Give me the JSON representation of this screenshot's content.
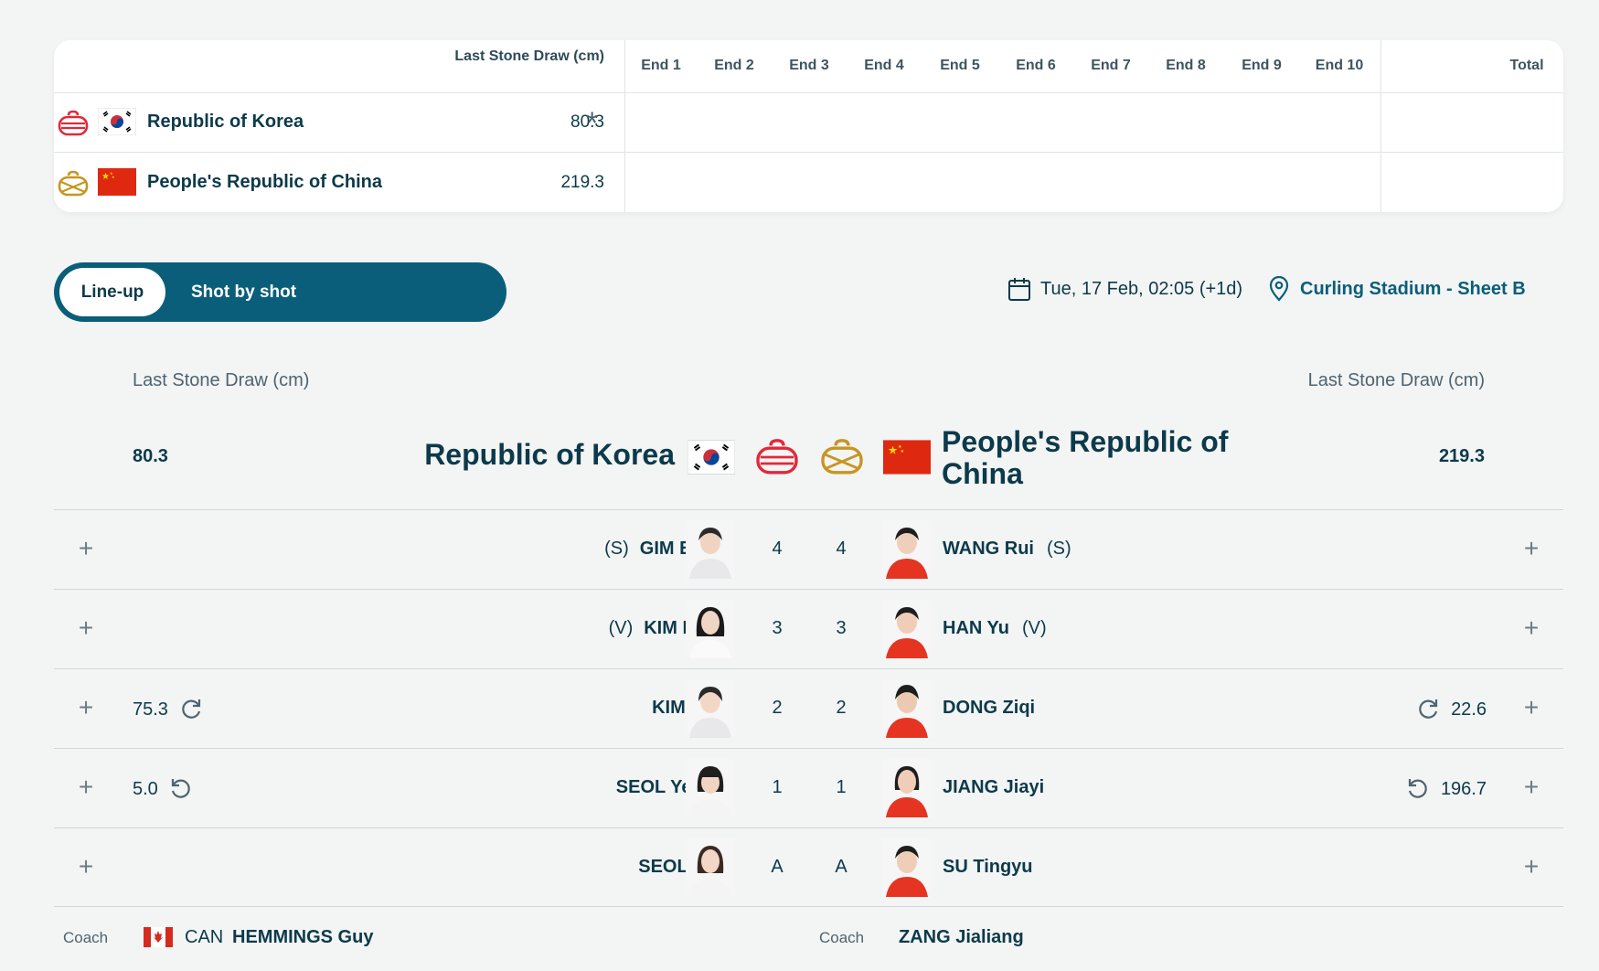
{
  "scoreboard": {
    "lsd_header": "Last Stone Draw (cm)",
    "ends": [
      "End 1",
      "End 2",
      "End 3",
      "End 4",
      "End 5",
      "End 6",
      "End 7",
      "End 8",
      "End 9",
      "End 10"
    ],
    "total_header": "Total",
    "teams": [
      {
        "name": "Republic of Korea",
        "lsd": "80.3",
        "hammer": "*",
        "stone_color": "#e0283a"
      },
      {
        "name": "People's Republic of China",
        "lsd": "219.3",
        "stone_color": "#c79520"
      }
    ]
  },
  "toggle": {
    "active": "Line-up",
    "other": "Shot by shot"
  },
  "meta": {
    "date": "Tue, 17 Feb, 02:05 (+1d)",
    "location": "Curling Stadium - Sheet B"
  },
  "lineup": {
    "lsd_label_left": "Last Stone Draw (cm)",
    "lsd_label_right": "Last Stone Draw (cm)",
    "left_lsd": "80.3",
    "right_lsd": "219.3",
    "left_team": "Republic of Korea",
    "right_team": "People's Republic of China",
    "rows": [
      {
        "left_name": "GIM Eunji",
        "left_role": "(S)",
        "left_pos": "4",
        "right_pos": "4",
        "right_name": "WANG Rui",
        "right_role": "(S)"
      },
      {
        "left_name": "KIM Minji",
        "left_role": "(V)",
        "left_pos": "3",
        "right_pos": "3",
        "right_name": "HAN Yu",
        "right_role": "(V)"
      },
      {
        "left_name": "KIM Suji",
        "left_pos": "2",
        "right_pos": "2",
        "right_name": "DONG Ziqi",
        "left_stat": "75.3",
        "right_stat": "22.6"
      },
      {
        "left_name": "SEOL Yeeun",
        "left_pos": "1",
        "right_pos": "1",
        "right_name": "JIANG Jiayi",
        "left_stat": "5.0",
        "right_stat": "196.7"
      },
      {
        "left_name": "SEOL Yeji",
        "left_pos": "A",
        "right_pos": "A",
        "right_name": "SU Tingyu"
      }
    ]
  },
  "coaches": {
    "label_left": "Coach",
    "label_right": "Coach",
    "left_noc": "CAN",
    "left_name": "HEMMINGS Guy",
    "right_name": "ZANG Jialiang"
  }
}
